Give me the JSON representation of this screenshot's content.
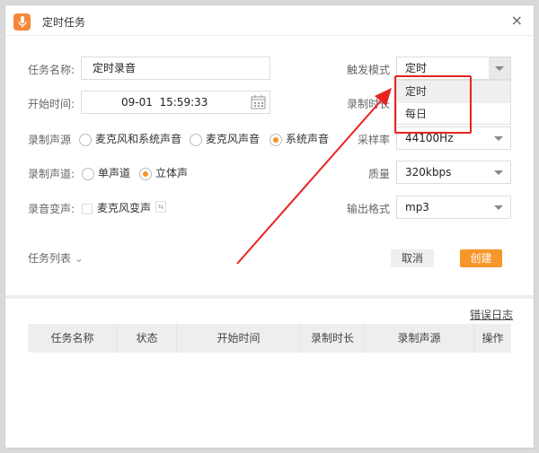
{
  "window": {
    "title": "定时任务",
    "close_icon": "×"
  },
  "form": {
    "task_name_label": "任务名称:",
    "task_name_value": "定时录音",
    "start_time_label": "开始时间:",
    "start_time_value": "09-01  15:59:33",
    "source_label": "录制声源",
    "source_options": [
      "麦克风和系统声音",
      "麦克风声音",
      "系统声音"
    ],
    "source_selected": "系统声音",
    "channel_label": "录制声道:",
    "channel_options": [
      "单声道",
      "立体声"
    ],
    "channel_selected": "立体声",
    "voice_change_label": "录音变声:",
    "voice_change_option": "麦克风变声",
    "trigger_label": "触发模式",
    "trigger_value": "定时",
    "trigger_options": [
      "定时",
      "每日"
    ],
    "duration_label": "录制时长",
    "sample_rate_label": "采样率",
    "sample_rate_value": "44100Hz",
    "quality_label": "质量",
    "quality_value": "320kbps",
    "format_label": "输出格式",
    "format_value": "mp3"
  },
  "actions": {
    "task_list": "任务列表",
    "cancel": "取消",
    "create": "创建"
  },
  "log_link": "错误日志",
  "table": {
    "columns": [
      "任务名称",
      "状态",
      "开始时间",
      "录制时长",
      "录制声源",
      "操作"
    ]
  },
  "colors": {
    "accent": "#f39425",
    "annotation": "#e8231f"
  }
}
